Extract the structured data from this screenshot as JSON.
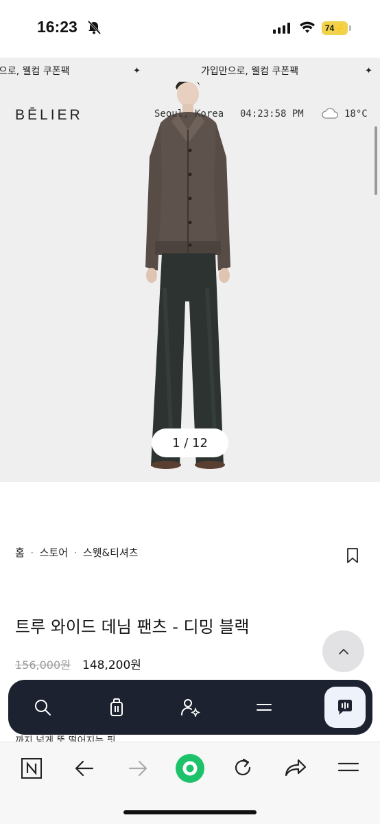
{
  "status_bar": {
    "time": "16:23",
    "battery": "74"
  },
  "banner": {
    "text_left": "으로, 웰컴 쿠폰팩",
    "text_right": "가입만으로, 웰컴 쿠폰팩",
    "separator": "✦"
  },
  "header": {
    "logo": "BĒLIER",
    "location": "Seoul, Korea",
    "clock": "04:23:58 PM",
    "temperature": "18°C"
  },
  "gallery": {
    "pager": "1 / 12"
  },
  "breadcrumb": {
    "items": [
      "홈",
      "스토어",
      "스웻&티셔츠"
    ],
    "sep": "·"
  },
  "product": {
    "title": "트루 와이드 데님 팬츠 - 디밍 블랙",
    "price_original": "156,000원",
    "price_sale": "148,200원",
    "description_peek": "까지 넓게 뚝 떨어지는 핏"
  },
  "icons": {
    "nav": [
      "search-icon",
      "shopping-bag-icon",
      "user-sparkle-icon",
      "menu-icon",
      "chat-icon"
    ],
    "browser": [
      "naver-icon",
      "back-arrow-icon",
      "forward-arrow-icon",
      "green-dot-icon",
      "refresh-icon",
      "share-icon",
      "hamburger-icon"
    ]
  },
  "colors": {
    "nav_bg": "#1c2230",
    "hero_bg": "#efeff0",
    "browser_accent": "#1ec26b"
  }
}
